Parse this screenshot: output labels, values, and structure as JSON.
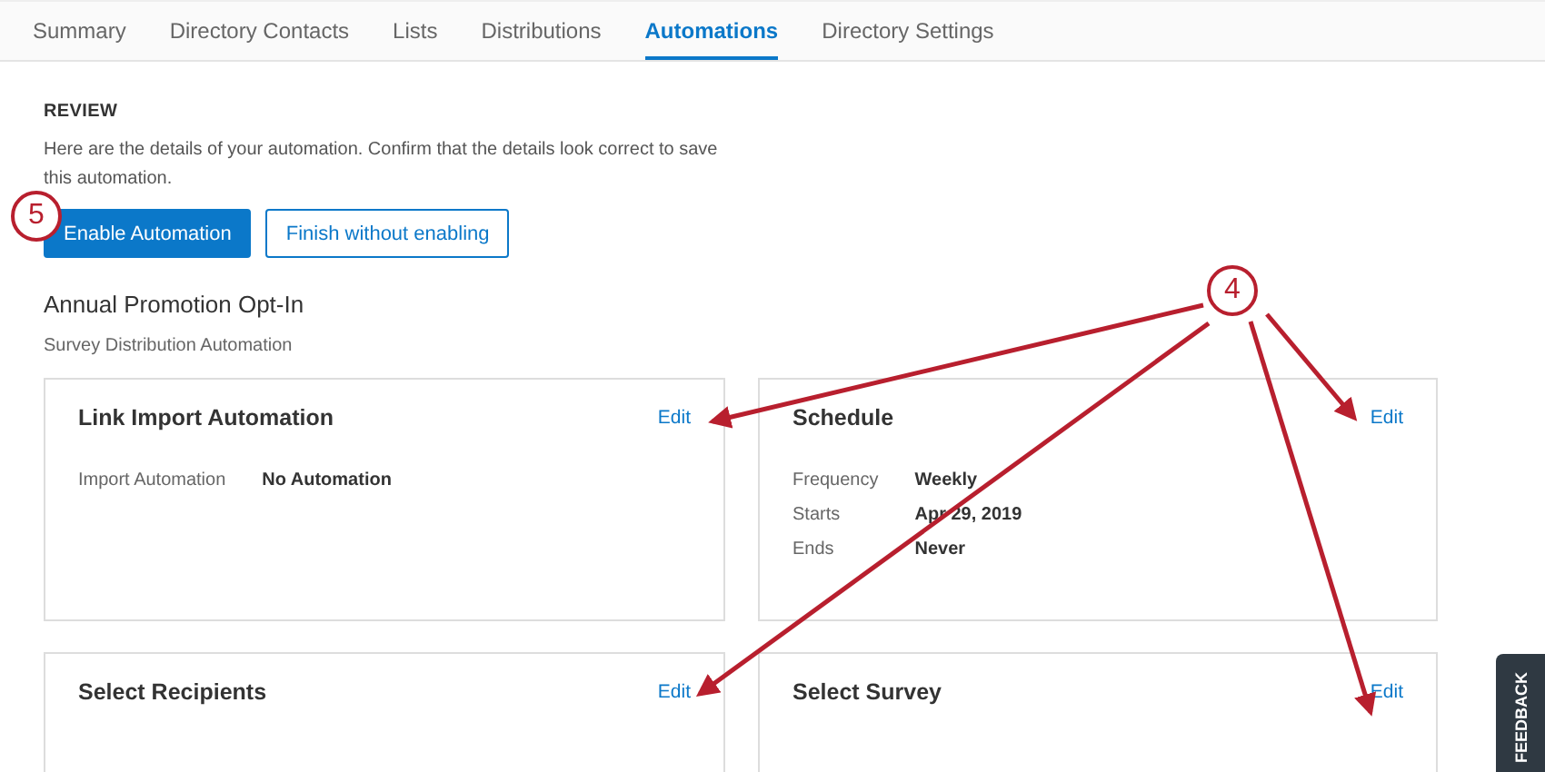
{
  "tabs": [
    {
      "label": "Summary",
      "selected": false
    },
    {
      "label": "Directory Contacts",
      "selected": false
    },
    {
      "label": "Lists",
      "selected": false
    },
    {
      "label": "Distributions",
      "selected": false
    },
    {
      "label": "Automations",
      "selected": true
    },
    {
      "label": "Directory Settings",
      "selected": false
    }
  ],
  "review": {
    "heading": "REVIEW",
    "description": "Here are the details of your automation. Confirm that the details look correct to save this automation.",
    "buttons": [
      {
        "label": "Enable Automation",
        "kind": "primary"
      },
      {
        "label": "Finish without enabling",
        "kind": "secondary"
      }
    ]
  },
  "automation": {
    "name": "Annual Promotion Opt-In",
    "type": "Survey Distribution Automation"
  },
  "cards": [
    {
      "title": "Link Import Automation",
      "edit": "Edit",
      "rows": [
        {
          "label": "Import Automation",
          "value": "No Automation"
        }
      ]
    },
    {
      "title": "Schedule",
      "edit": "Edit",
      "rows": [
        {
          "label": "Frequency",
          "value": "Weekly"
        },
        {
          "label": "Starts",
          "value": "Apr 29, 2019"
        },
        {
          "label": "Ends",
          "value": "Never"
        }
      ]
    },
    {
      "title": "Select Recipients",
      "edit": "Edit"
    },
    {
      "title": "Select Survey",
      "edit": "Edit"
    }
  ],
  "callouts": [
    {
      "number": "5"
    },
    {
      "number": "4"
    }
  ],
  "feedback": "FEEDBACK"
}
